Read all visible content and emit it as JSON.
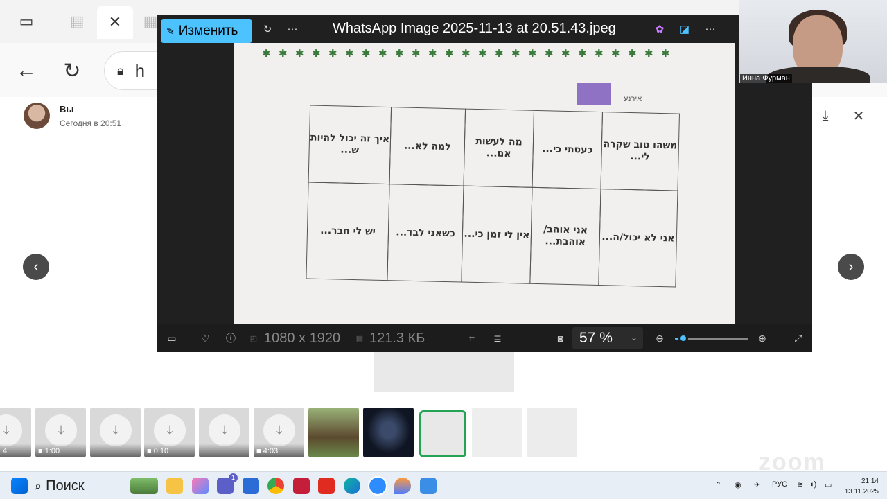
{
  "browser": {
    "address_partial": "h"
  },
  "chat": {
    "sender_name": "Вы",
    "sender_time": "Сегодня в 20:51"
  },
  "photos": {
    "edit_label": "Изменить",
    "title": "WhatsApp Image 2025-11-13 at 20.51.43.jpeg",
    "dimensions": "1080 x 1920",
    "file_size": "121.3 КБ",
    "zoom": "57 %",
    "zoom_level_percent": 57
  },
  "worksheet": {
    "name_label": "אירנע",
    "cells": [
      {
        "text": "משהו טוב שקרה לי..."
      },
      {
        "text": "כעסתי כי..."
      },
      {
        "text": "מה לעשות אם..."
      },
      {
        "text": "למה לא..."
      },
      {
        "text": "איך זה יכול להיות ש..."
      },
      {
        "text": "אני לא יכול/ה..."
      },
      {
        "text": "אני אוהב/ אוהבת..."
      },
      {
        "text": "אין לי זמן כי..."
      },
      {
        "text": "כשאני לבד..."
      },
      {
        "text": "יש לי חבר..."
      }
    ]
  },
  "thumbnails": [
    {
      "kind": "download",
      "duration": "4"
    },
    {
      "kind": "download",
      "duration": "1:00"
    },
    {
      "kind": "download",
      "duration": ""
    },
    {
      "kind": "download",
      "duration": "0:10"
    },
    {
      "kind": "download",
      "duration": ""
    },
    {
      "kind": "download",
      "duration": "4:03"
    },
    {
      "kind": "image"
    },
    {
      "kind": "image"
    },
    {
      "kind": "image",
      "selected": true
    },
    {
      "kind": "image"
    },
    {
      "kind": "image"
    }
  ],
  "webcam": {
    "participant_name": "Инна Фурман"
  },
  "watermark": "zoom",
  "taskbar": {
    "search_label": "Поиск",
    "language": "РУС",
    "time": "21:14",
    "date": "13.11.2025",
    "teams_badge": "1"
  },
  "colors": {
    "accent": "#4cc2ff",
    "selected_thumb": "#23a455"
  }
}
